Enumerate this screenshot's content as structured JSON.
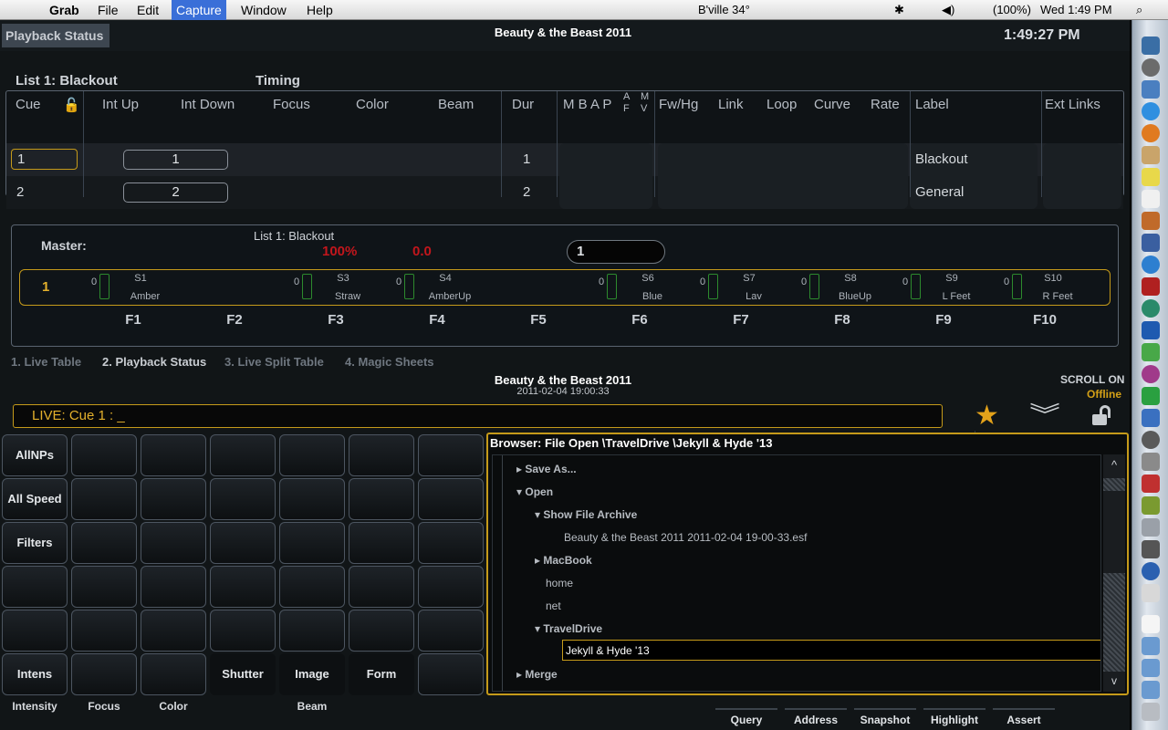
{
  "menubar": {
    "app": "Grab",
    "items": [
      "File",
      "Edit",
      "Capture",
      "Window",
      "Help"
    ],
    "weather": "B'ville 34°",
    "battery": "(100%)",
    "clock": "Wed 1:49 PM"
  },
  "header": {
    "tab": "Playback Status",
    "show_title": "Beauty & the Beast 2011",
    "time": "1:49:27 PM"
  },
  "cuelist": {
    "list_label": "List 1: Blackout",
    "timing_label": "Timing",
    "columns": {
      "cue": "Cue",
      "int_up": "Int Up",
      "int_down": "Int Down",
      "focus": "Focus",
      "color": "Color",
      "beam": "Beam",
      "dur": "Dur",
      "mbap": "M B A P",
      "af": "A F",
      "mv": "M V",
      "fwhg": "Fw/Hg",
      "link": "Link",
      "loop": "Loop",
      "curve": "Curve",
      "rate": "Rate",
      "label": "Label",
      "ext": "Ext Links"
    },
    "rows": [
      {
        "cue": "1",
        "time": "1",
        "dur": "1",
        "label": "Blackout"
      },
      {
        "cue": "2",
        "time": "2",
        "dur": "2",
        "label": "General"
      }
    ]
  },
  "master": {
    "label": "Master:",
    "list": "List 1: Blackout",
    "percent": "100%",
    "value": "0.0",
    "cue_field": "1",
    "page": "1",
    "faders": [
      {
        "n": "S1",
        "l": "Amber"
      },
      {
        "n": "S3",
        "l": "Straw"
      },
      {
        "n": "S4",
        "l": "AmberUp"
      },
      {
        "n": "S6",
        "l": "Blue"
      },
      {
        "n": "S7",
        "l": "Lav"
      },
      {
        "n": "S8",
        "l": "BlueUp"
      },
      {
        "n": "S9",
        "l": "L Feet"
      },
      {
        "n": "S10",
        "l": "R Feet"
      }
    ],
    "zero": "0",
    "fkeys": [
      "F1",
      "F2",
      "F3",
      "F4",
      "F5",
      "F6",
      "F7",
      "F8",
      "F9",
      "F10"
    ]
  },
  "tabs": [
    "1. Live Table",
    "2. Playback Status",
    "3. Live Split Table",
    "4. Magic Sheets"
  ],
  "status": {
    "title": "Beauty & the Beast 2011",
    "date": "2011-02-04 19:00:33",
    "scroll": "SCROLL ON",
    "offline": "Offline"
  },
  "command": {
    "text": "LIVE: Cue  1 :  _"
  },
  "buttons": {
    "allnps": "AllNPs",
    "allspeed": "All Speed",
    "filters": "Filters",
    "intens": "Intens",
    "shutter": "Shutter",
    "image": "Image",
    "form": "Form"
  },
  "categories": {
    "intensity": "Intensity",
    "focus": "Focus",
    "color": "Color",
    "beam": "Beam"
  },
  "browser": {
    "title": "Browser: File Open \\TravelDrive \\Jekyll & Hyde '13",
    "nodes": [
      "Save As...",
      "Open",
      "Show File Archive",
      "Beauty & the Beast 2011 2011-02-04 19-00-33.esf",
      "MacBook",
      "home",
      "net",
      "TravelDrive",
      "Jekyll & Hyde '13",
      "Merge"
    ],
    "scroll_up": "^",
    "scroll_down": "v"
  },
  "bottom_buttons": [
    "Query",
    "Address",
    "Snapshot",
    "Highlight",
    "Assert"
  ]
}
